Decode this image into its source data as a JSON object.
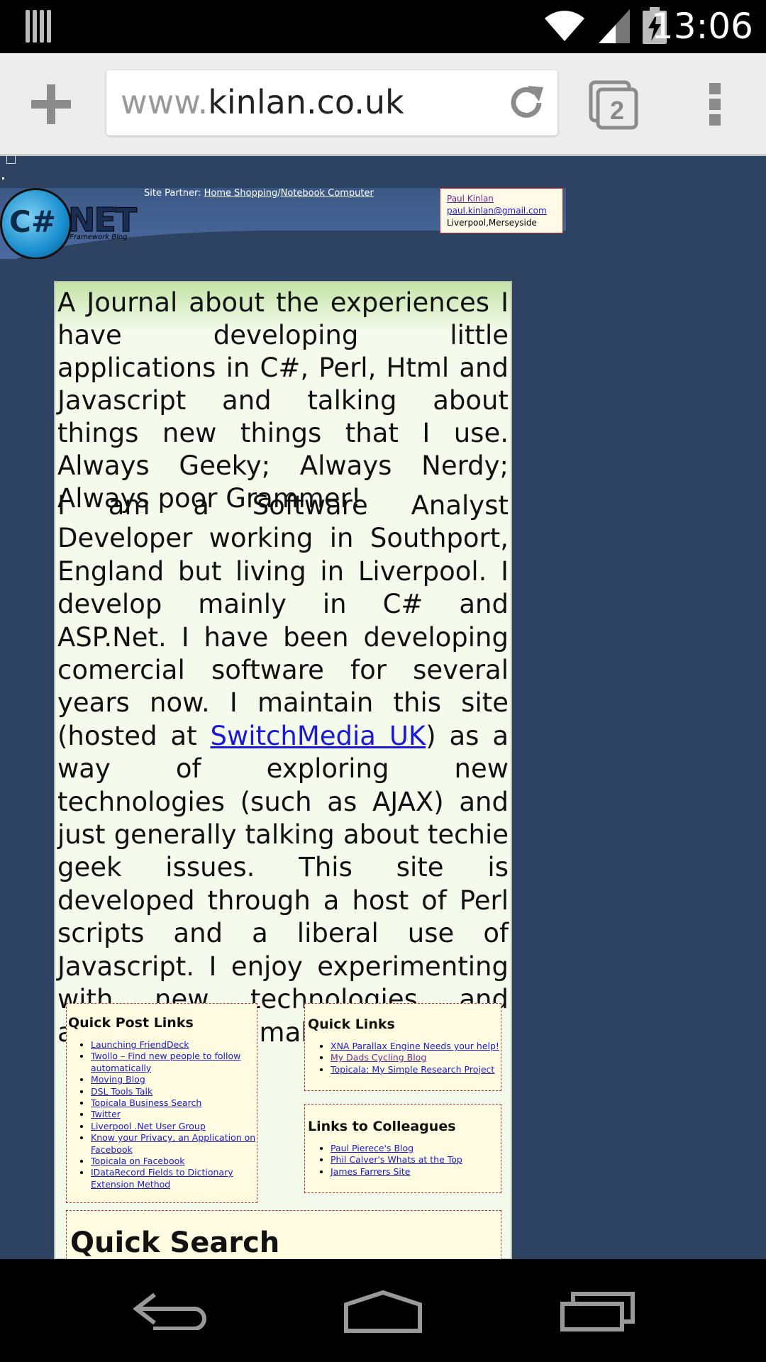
{
  "status_bar": {
    "time": "13:06",
    "icons": [
      "notifications-icon",
      "wifi-icon",
      "signal-icon",
      "battery-charging-icon"
    ]
  },
  "browser": {
    "url_prefix": "www.",
    "url_domain": "kinlan.co.uk",
    "tab_count": "2",
    "icons": [
      "new-tab-icon",
      "reload-icon",
      "tabs-icon",
      "menu-icon"
    ]
  },
  "header": {
    "logo_cs": "C#",
    "logo_net": "NET",
    "logo_sub": "Framework Blog",
    "partner_label": "Site Partner: ",
    "partner_link1": "Home Shopping",
    "partner_sep": "/",
    "partner_link2": "Notebook Computer"
  },
  "contact": {
    "name": "Paul Kinlan",
    "email": "paul.kinlan@gmail.com",
    "location": "Liverpool,Merseyside"
  },
  "content": {
    "intro": "A Journal about the experiences I have developing little applications in C#, Perl, Html and Javascript and talking about things new things that I use. Always Geeky; Always Nerdy; Always poor Grammer!",
    "about_before": "I am a Software Analyst Developer working in Southport, England but living in Liverpool. I develop mainly in C# and ASP.Net. I have been developing comercial software for several years now. I maintain this site (hosted at ",
    "about_link": "SwitchMedia UK",
    "about_after": ") as a way of exploring new technologies (such as AJAX) and just generally talking about techie geek issues. This site is developed through a host of Perl scripts and a liberal use of Javascript. I enjoy experimenting with new technologies and anything that I make I host here."
  },
  "quick_post": {
    "title": "Quick Post Links",
    "items": [
      "Launching FriendDeck",
      "Twollo – Find new people to follow automatically",
      "Moving Blog",
      "DSL Tools Talk",
      "Topicala Business Search",
      "Twitter",
      "Liverpool .Net User Group",
      "Know your Privacy, an Application on Facebook",
      "Topicala on Facebook",
      "IDataRecord Fields to Dictionary Extension Method"
    ]
  },
  "quick_links": {
    "title": "Quick Links",
    "items": [
      "XNA Parallax Engine Needs your help!",
      "My Dads Cycling Blog",
      "Topicala: My Simple Research Project"
    ]
  },
  "colleagues": {
    "title": "Links to Colleagues",
    "items": [
      "Paul Pierece's Blog",
      "Phil Calver's Whats at the Top",
      "James Farrers Site"
    ]
  },
  "quick_search": {
    "title": "Quick Search"
  },
  "nav": {
    "icons": [
      "back-icon",
      "home-icon",
      "recents-icon"
    ]
  }
}
